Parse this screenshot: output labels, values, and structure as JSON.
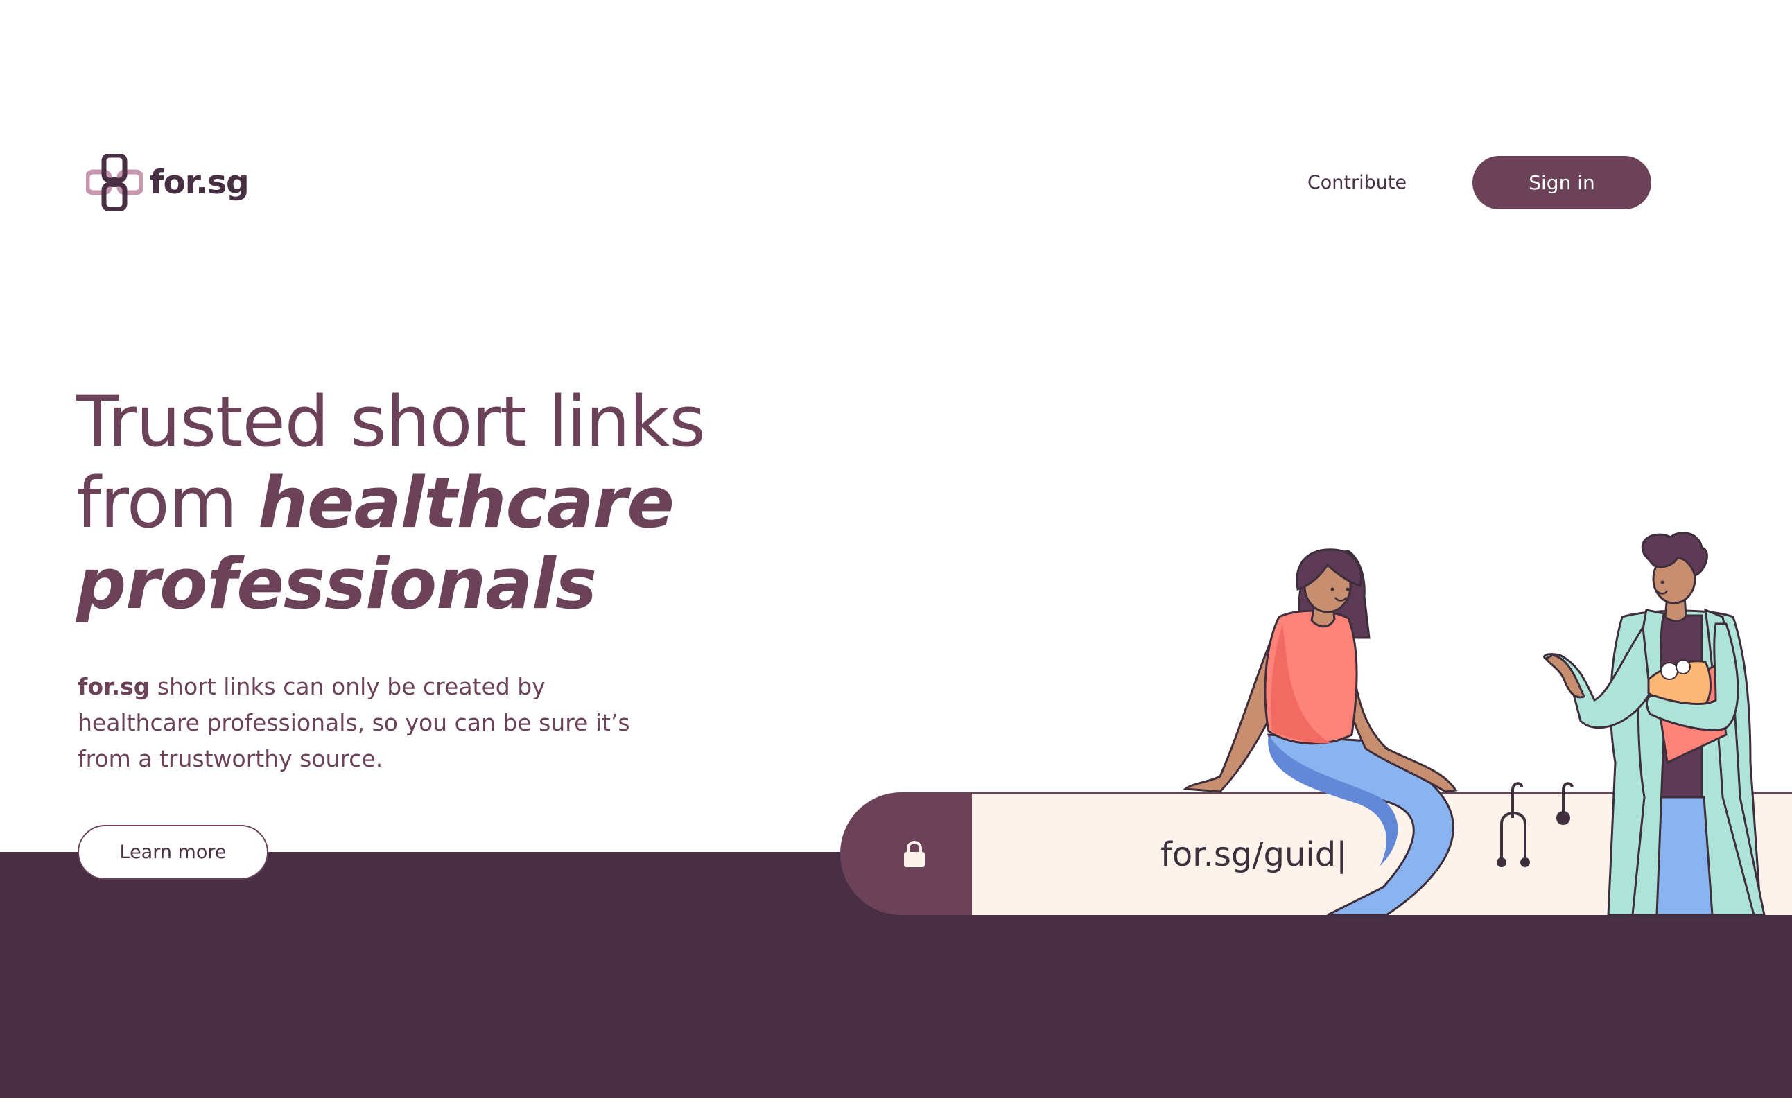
{
  "header": {
    "logo_text": "for.sg",
    "nav": {
      "contribute": "Contribute"
    },
    "sign_in": "Sign in"
  },
  "hero": {
    "title_line1": "Trusted short links",
    "title_line2_regular": "from ",
    "title_line2_emph": "healthcare",
    "title_line3_emph": "professionals",
    "desc_brand": "for.sg",
    "desc_line1": " short links can only be created by",
    "desc_line2": "healthcare professionals, so you can be sure it’s",
    "desc_line3": "from a trustworthy source.",
    "learn_more": "Learn more"
  },
  "url_bar": {
    "text": "for.sg/guid|",
    "icon": "lock-icon"
  },
  "colors": {
    "brand": "#6b4257",
    "dark_band": "#482f43",
    "url_field": "#fdf3ea"
  }
}
